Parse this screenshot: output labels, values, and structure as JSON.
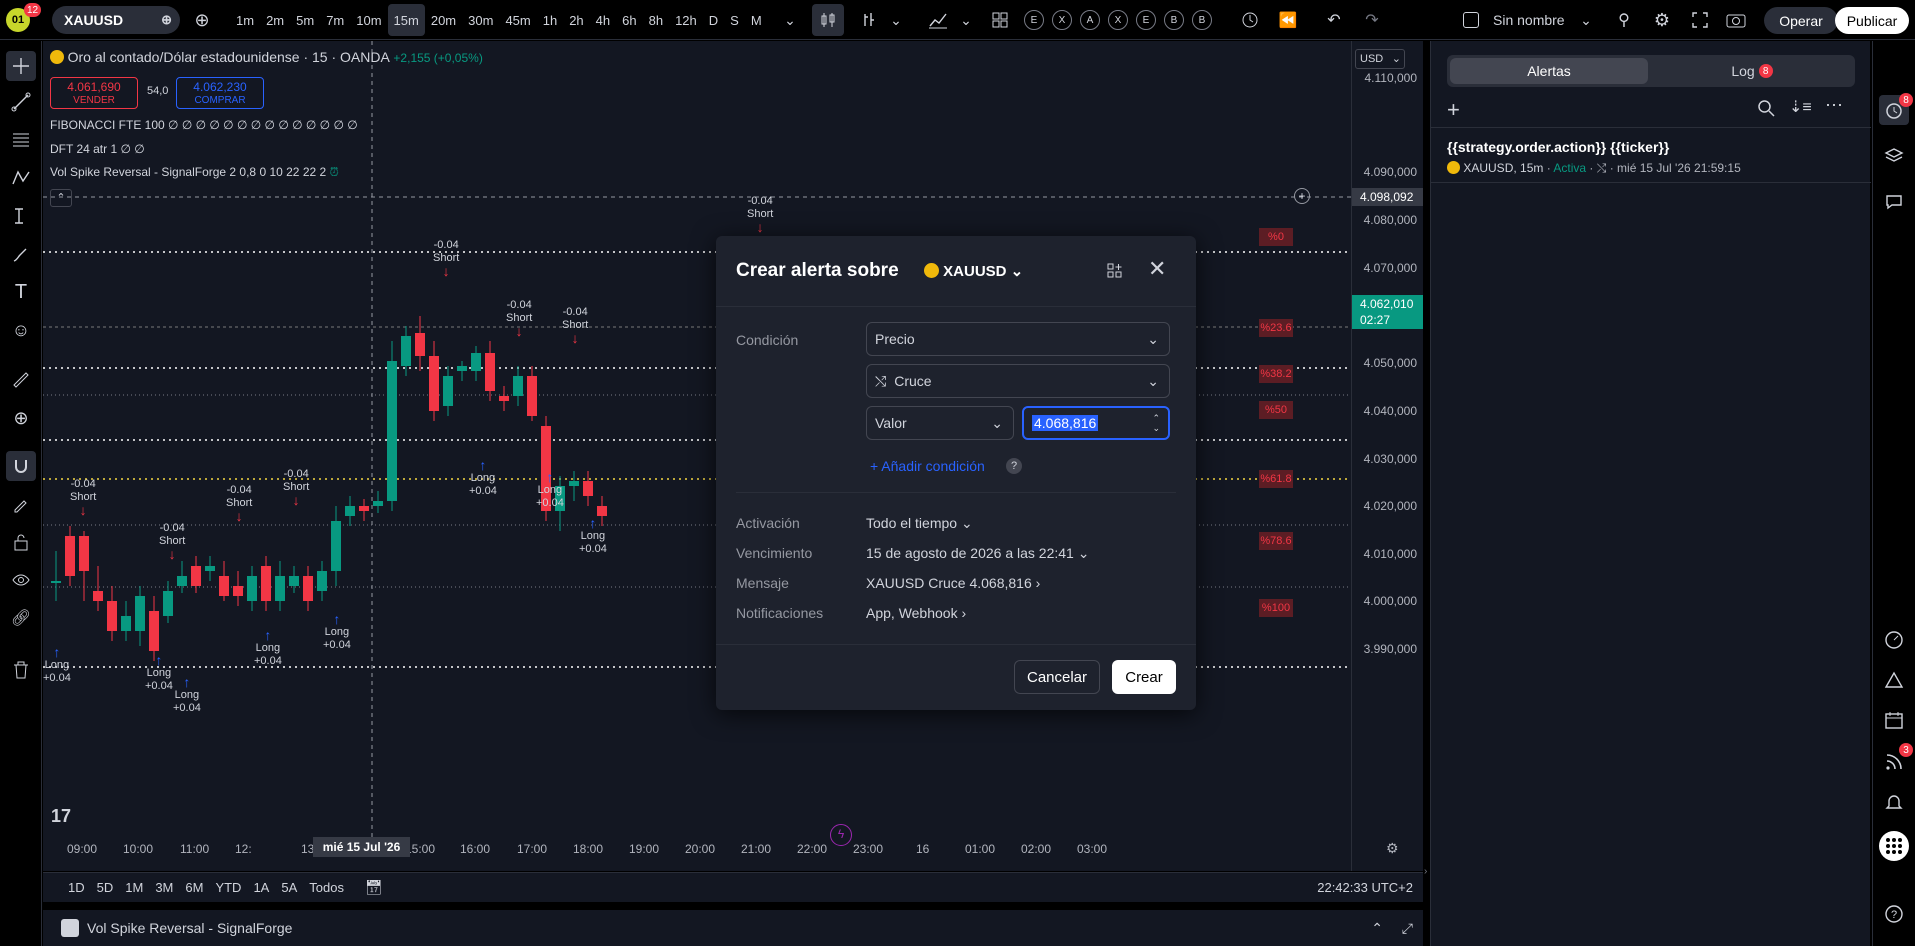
{
  "topbar": {
    "avatar_badge": "12",
    "symbol": "XAUUSD",
    "intervals": [
      "1m",
      "2m",
      "5m",
      "7m",
      "10m",
      "15m",
      "20m",
      "30m",
      "45m",
      "1h",
      "2h",
      "4h",
      "6h",
      "8h",
      "12h",
      "D",
      "S",
      "M"
    ],
    "active_interval": "15m",
    "indicator_letters": [
      "E",
      "X",
      "A",
      "X",
      "E",
      "B",
      "B"
    ],
    "layout_name": "Sin nombre",
    "trade_label": "Operar",
    "publish_label": "Publicar"
  },
  "chart": {
    "title": "Oro al contado/Dólar estadounidense · 15 · OANDA",
    "change": "+2,155 (+0,05%)",
    "sell_price": "4.061,690",
    "sell_label": "VENDER",
    "spread": "54,0",
    "buy_price": "4.062,230",
    "buy_label": "COMPRAR",
    "ind1": "FIBONACCI FTE 100  ∅ ∅ ∅ ∅ ∅ ∅ ∅ ∅ ∅ ∅ ∅ ∅ ∅ ∅",
    "ind2": "DFT 24 atr 1  ∅ ∅",
    "ind3": "Vol Spike Reversal - SignalForge 2 0,8 0 10 22 22 2",
    "currency": "USD",
    "price_labels": [
      "4.110,000",
      "4.090,000",
      "4.080,000",
      "4.070,000",
      "4.050,000",
      "4.040,000",
      "4.030,000",
      "4.020,000",
      "4.010,000",
      "4.000,000",
      "3.990,000"
    ],
    "crosshair_price": "4.098,092",
    "current_price": "4.062,010",
    "countdown": "02:27",
    "time_labels": [
      "09:00",
      "10:00",
      "11:00",
      "12:",
      "13:00",
      "15:00",
      "16:00",
      "17:00",
      "18:00",
      "19:00",
      "20:00",
      "21:00",
      "22:00",
      "23:00",
      "16",
      "01:00",
      "02:00",
      "03:00"
    ],
    "crosshair_time": "mié 15 Jul '26",
    "fib_labels": [
      "%0",
      "%23.6",
      "%38.2",
      "%50",
      "%61.8",
      "%78.6",
      "%100"
    ],
    "short_text": "Short",
    "long_text": "Long",
    "neg_val": "-0.04",
    "pos_val": "+0.04"
  },
  "bottombar": {
    "ranges": [
      "1D",
      "5D",
      "1M",
      "3M",
      "6M",
      "YTD",
      "1A",
      "5A",
      "Todos"
    ],
    "clock": "22:42:33 UTC+2"
  },
  "panel": {
    "title": "Vol Spike Reversal - SignalForge"
  },
  "dialog": {
    "title": "Crear alerta sobre",
    "symbol": "XAUUSD",
    "condition_label": "Condición",
    "source": "Precio",
    "operator": "Cruce",
    "value_type": "Valor",
    "value": "4.068,816",
    "add_condition": "Añadir condición",
    "activation_label": "Activación",
    "activation_value": "Todo el tiempo",
    "expiry_label": "Vencimiento",
    "expiry_value": "15 de agosto de 2026 a las 22:41",
    "message_label": "Mensaje",
    "message_value": "XAUUSD Cruce 4.068,816",
    "notif_label": "Notificaciones",
    "notif_value": "App, Webhook",
    "cancel": "Cancelar",
    "create": "Crear"
  },
  "right": {
    "tab_alerts": "Alertas",
    "tab_log": "Log",
    "log_badge": "8",
    "alert_title": "{{strategy.order.action}} {{ticker}}",
    "alert_symbol": "XAUUSD, 15m",
    "alert_status": "Activa",
    "alert_time": "mié 15 Jul '26   21:59:15",
    "alerts_badge": "8",
    "feed_badge": "3"
  }
}
